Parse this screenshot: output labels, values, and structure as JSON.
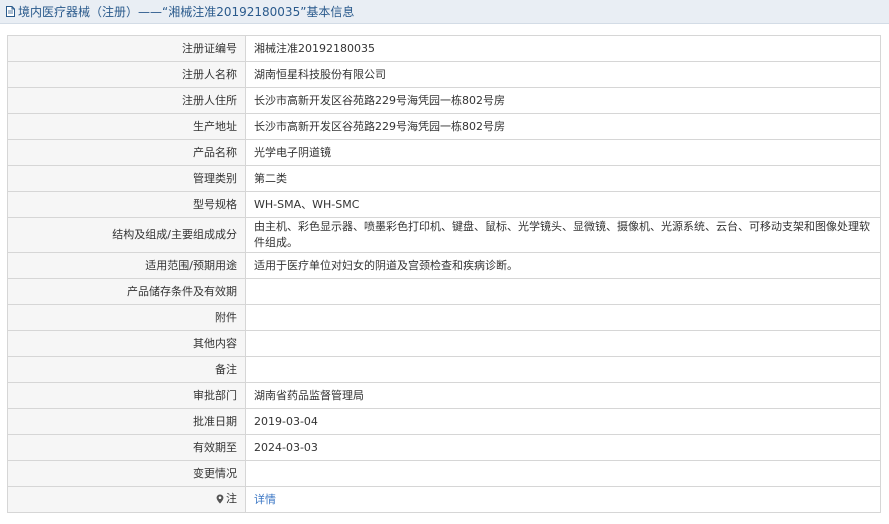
{
  "header": {
    "title": "境内医疗器械（注册）——“湘械注准20192180035”基本信息"
  },
  "rows": [
    {
      "label": "注册证编号",
      "value": "湘械注准20192180035"
    },
    {
      "label": "注册人名称",
      "value": "湖南恒星科技股份有限公司"
    },
    {
      "label": "注册人住所",
      "value": "长沙市高新开发区谷苑路229号海凭园一栋802号房"
    },
    {
      "label": "生产地址",
      "value": "长沙市高新开发区谷苑路229号海凭园一栋802号房"
    },
    {
      "label": "产品名称",
      "value": "光学电子阴道镜"
    },
    {
      "label": "管理类别",
      "value": "第二类"
    },
    {
      "label": "型号规格",
      "value": "WH-SMA、WH-SMC"
    },
    {
      "label": "结构及组成/主要组成成分",
      "value": "由主机、彩色显示器、喷墨彩色打印机、键盘、鼠标、光学镜头、显微镜、摄像机、光源系统、云台、可移动支架和图像处理软件组成。"
    },
    {
      "label": "适用范围/预期用途",
      "value": "适用于医疗单位对妇女的阴道及宫颈检查和疾病诊断。"
    },
    {
      "label": "产品储存条件及有效期",
      "value": ""
    },
    {
      "label": "附件",
      "value": ""
    },
    {
      "label": "其他内容",
      "value": ""
    },
    {
      "label": "备注",
      "value": ""
    },
    {
      "label": "审批部门",
      "value": "湖南省药品监督管理局"
    },
    {
      "label": "批准日期",
      "value": "2019-03-04"
    },
    {
      "label": "有效期至",
      "value": "2024-03-03"
    },
    {
      "label": "变更情况",
      "value": ""
    }
  ],
  "note": {
    "label": "注",
    "link_text": "详情"
  },
  "colors": {
    "link": "#3a76c4",
    "title": "#2a5a8c"
  }
}
